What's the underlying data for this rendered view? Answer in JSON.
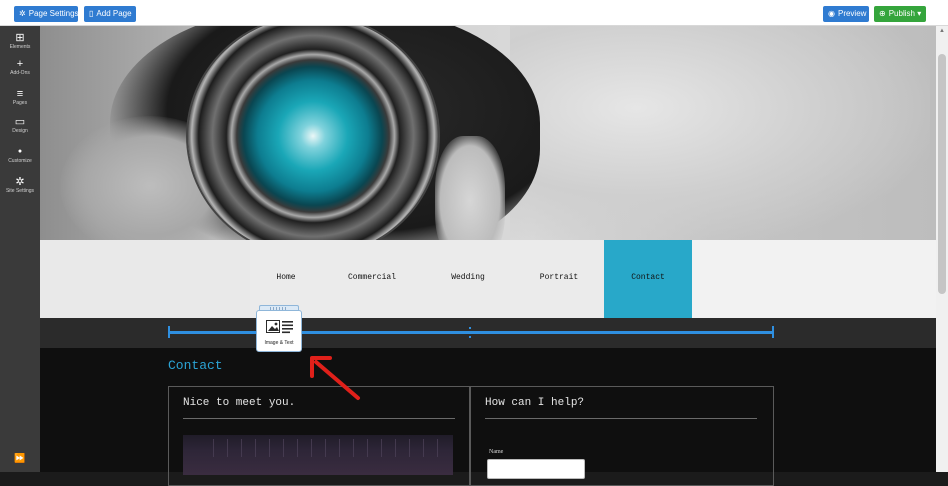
{
  "toolbar": {
    "page_settings_label": "Page Settings",
    "add_page_label": "Add Page",
    "preview_label": "Preview",
    "publish_label": "Publish",
    "publish_caret": "▾"
  },
  "sidebar": {
    "items": [
      {
        "label": "Elements",
        "icon": "grid-icon",
        "glyph": "⊞"
      },
      {
        "label": "Add-Ons",
        "icon": "plus-icon",
        "glyph": "+"
      },
      {
        "label": "Pages",
        "icon": "pages-icon",
        "glyph": "≡"
      },
      {
        "label": "Design",
        "icon": "monitor-icon",
        "glyph": "▭"
      },
      {
        "label": "Customize",
        "icon": "drop-icon",
        "glyph": "●"
      },
      {
        "label": "Site Settings",
        "icon": "gear-icon",
        "glyph": "✲"
      }
    ],
    "collapse_glyph": "⏩"
  },
  "nav": {
    "items": [
      "Home",
      "Commercial",
      "Wedding",
      "Portrait",
      "Contact"
    ],
    "active": "Contact",
    "active_color": "#28a8c9"
  },
  "content": {
    "heading": "Contact",
    "left_title": "Nice to meet you.",
    "right_title": "How can I help?",
    "name_label": "Name"
  },
  "drag_widget": {
    "label": "Image & Text",
    "icon": "image-text-icon"
  },
  "colors": {
    "toolbar_blue": "#2f7bd1",
    "publish_green": "#35a53c",
    "drop_line": "#2f8fe0",
    "heading_blue": "#2ba3d4",
    "annotation_red": "#e0201a"
  }
}
